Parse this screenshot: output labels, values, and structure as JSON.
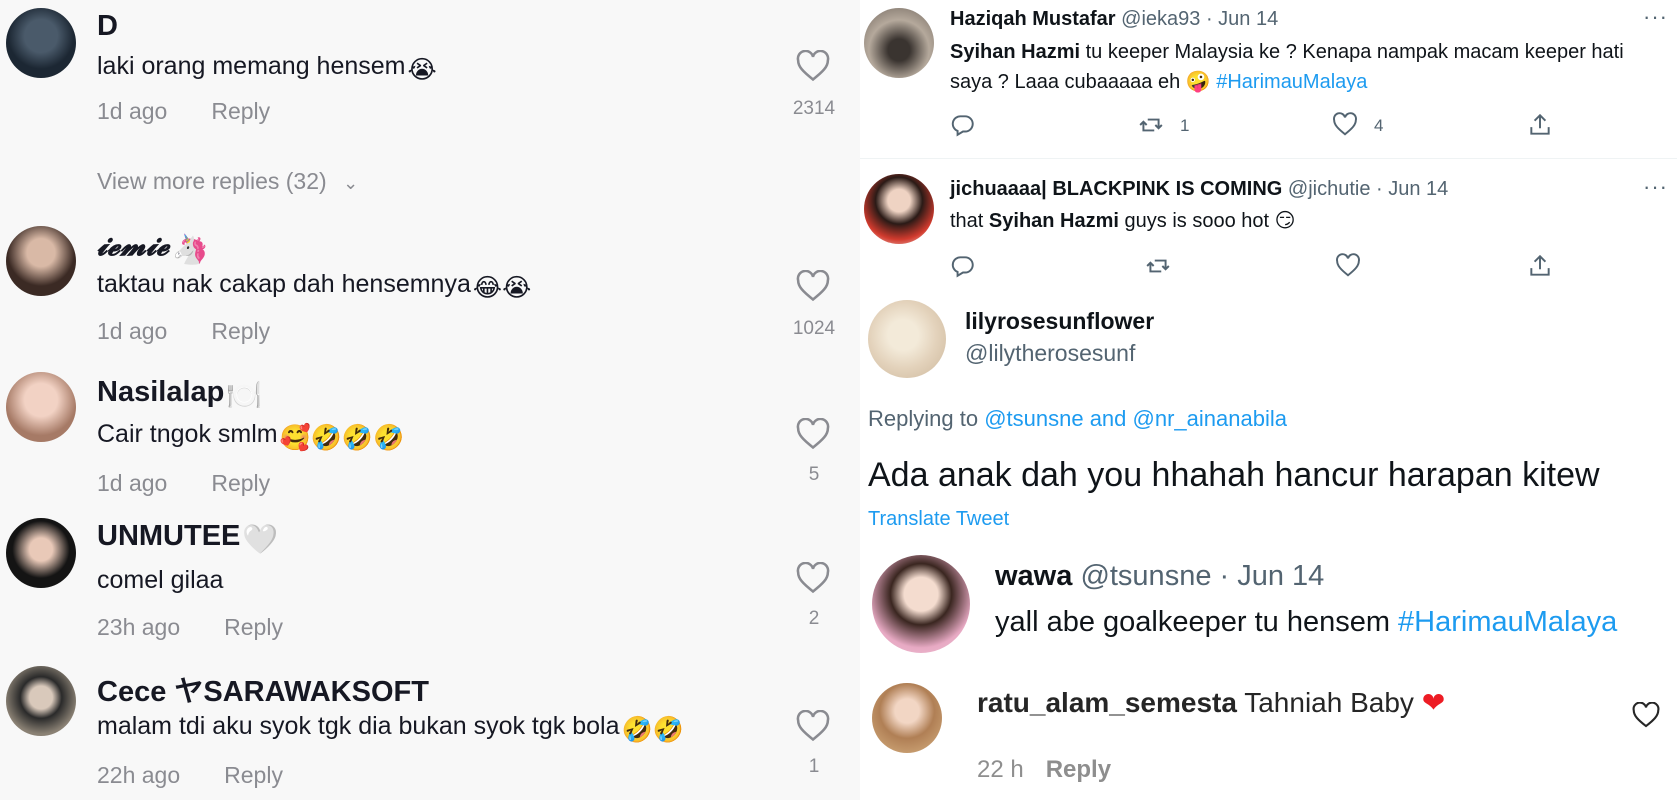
{
  "tiktok": {
    "comments": [
      {
        "name": "D",
        "text": "laki orang memang hensem",
        "time": "1d ago",
        "reply": "Reply",
        "likes": "2314"
      },
      {
        "name": "𝓲𝓮𝓶𝓲𝓮",
        "text": "taktau nak cakap dah hensemnya",
        "time": "1d ago",
        "reply": "Reply",
        "likes": "1024"
      },
      {
        "name": "Nasilalap",
        "text": "Cair tngok smlm",
        "time": "1d ago",
        "reply": "Reply",
        "likes": "5"
      },
      {
        "name": "UNMUTEE",
        "text": "comel gilaa",
        "time": "23h ago",
        "reply": "Reply",
        "likes": "2"
      },
      {
        "name": "Cece ヤSARAWAKSOFT",
        "text": "malam tdi aku syok tgk dia bukan syok tgk bola",
        "time": "22h ago",
        "reply": "Reply",
        "likes": "1"
      }
    ],
    "view_more": "View more replies (32)"
  },
  "twitter": {
    "tweet1": {
      "name": "Haziqah Mustafar",
      "handle": "@ieka93 · Jun 14",
      "bold": "Syihan Hazmi",
      "text1": " tu keeper Malaysia ke ? Kenapa nampak macam keeper hati saya ? Laaa cubaaaaa eh ",
      "hashtag": "#HarimauMalaya",
      "retweets": "1",
      "likes": "4",
      "more": "···"
    },
    "tweet2": {
      "name": "jichuaaaa| BLACKPINK IS COMING",
      "handle": "@jichutie · Jun 14",
      "pre": "that ",
      "bold": "Syihan Hazmi",
      "post": " guys is sooo hot",
      "more": "···"
    },
    "tweet3": {
      "name": "lilyrosesunflower",
      "handle": "@lilytherosesunf",
      "replying_label": "Replying to ",
      "replying_to1": "@tsunsne",
      "replying_and": " and ",
      "replying_to2": "@nr_ainanabila",
      "text": "Ada anak dah you hhahah hancur harapan kitew",
      "translate": "Translate Tweet"
    },
    "tweet4": {
      "name": "wawa",
      "handle": "@tsunsne · Jun 14",
      "text": "yall abe goalkeeper tu hensem ",
      "hashtag": "#HarimauMalaya"
    }
  },
  "instagram": {
    "username": "ratu_alam_semesta",
    "text": " Tahniah Baby ",
    "time": "22 h",
    "reply": "Reply"
  },
  "colors": {
    "tiktok_bg": "#f8f8f8",
    "twitter_link": "#1d9bf0",
    "muted": "#8a8b91"
  }
}
